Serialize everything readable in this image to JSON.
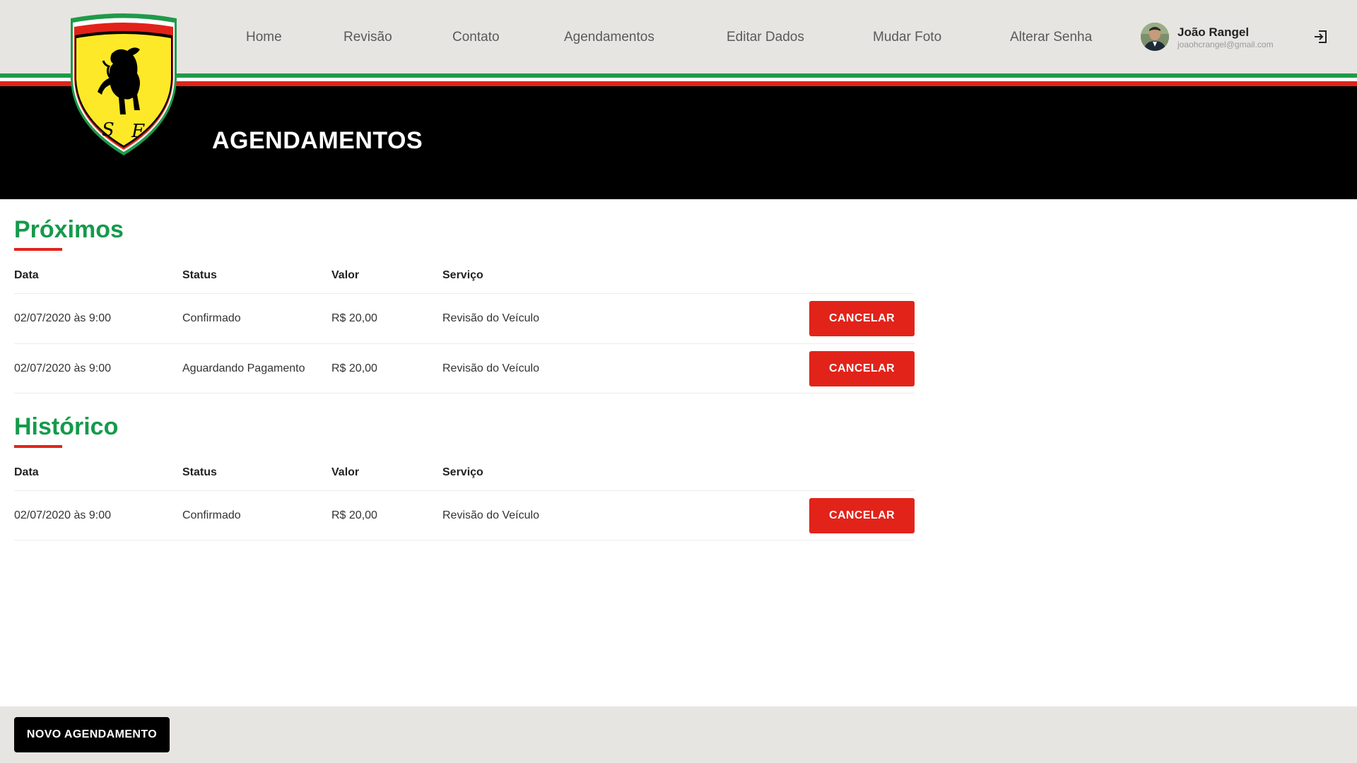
{
  "header": {
    "nav": [
      {
        "label": "Home"
      },
      {
        "label": "Revisão"
      },
      {
        "label": "Contato"
      },
      {
        "label": "Agendamentos"
      },
      {
        "label": "Editar Dados"
      },
      {
        "label": "Mudar Foto"
      },
      {
        "label": "Alterar Senha"
      }
    ],
    "user": {
      "name": "João Rangel",
      "email": "joaohcrangel@gmail.com"
    },
    "logo_icon": "ferrari-shield-logo",
    "logout_icon": "logout-icon"
  },
  "hero": {
    "title": "AGENDAMENTOS"
  },
  "upcoming": {
    "title": "Próximos",
    "columns": [
      "Data",
      "Status",
      "Valor",
      "Serviço"
    ],
    "rows": [
      {
        "date": "02/07/2020 às 9:00",
        "status": "Confirmado",
        "value": "R$ 20,00",
        "service": "Revisão do Veículo",
        "action": "CANCELAR"
      },
      {
        "date": "02/07/2020 às 9:00",
        "status": "Aguardando Pagamento",
        "value": "R$ 20,00",
        "service": "Revisão do Veículo",
        "action": "CANCELAR"
      }
    ]
  },
  "history": {
    "title": "Histórico",
    "columns": [
      "Data",
      "Status",
      "Valor",
      "Serviço"
    ],
    "rows": [
      {
        "date": "02/07/2020 às 9:00",
        "status": "Confirmado",
        "value": "R$ 20,00",
        "service": "Revisão do Veículo",
        "action": "CANCELAR"
      }
    ]
  },
  "footer": {
    "new_button": "NOVO AGENDAMENTO"
  },
  "colors": {
    "accent_green": "#159a4c",
    "accent_red": "#e2231a",
    "header_bg": "#e6e5e2",
    "hero_bg": "#000000",
    "logo_yellow": "#fde928"
  }
}
